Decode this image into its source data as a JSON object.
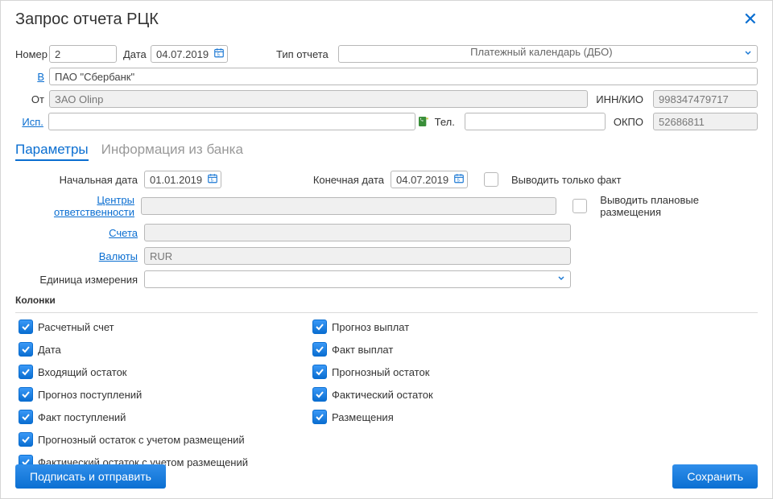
{
  "window": {
    "title": "Запрос отчета РЦК"
  },
  "header": {
    "number_label": "Номер",
    "number_value": "2",
    "date_label": "Дата",
    "date_value": "04.07.2019",
    "type_label": "Тип отчета",
    "type_value": "Платежный календарь (ДБО)",
    "b_label": "В",
    "b_value": "ПАО \"Сбербанк\"",
    "ot_label": "От",
    "ot_value": "ЗАО Olinp",
    "inn_label": "ИНН/КИО",
    "inn_value": "998347479717",
    "isp_label": "Исп.",
    "isp_value": "",
    "tel_label": "Тел.",
    "tel_value": "",
    "okpo_label": "ОКПО",
    "okpo_value": "52686811"
  },
  "tabs": {
    "params": "Параметры",
    "bank_info": "Информация из банка"
  },
  "params": {
    "start_date_label": "Начальная дата",
    "start_date_value": "01.01.2019",
    "end_date_label": "Конечная дата",
    "end_date_value": "04.07.2019",
    "fact_only_label": "Выводить только факт",
    "resp_centers_label": "Центры ответственности",
    "plan_placements_label": "Выводить плановые размещения",
    "accounts_label": "Счета",
    "currencies_label": "Валюты",
    "currencies_value": "RUR",
    "unit_label": "Единица измерения",
    "unit_value": ""
  },
  "columns_section_label": "Колонки",
  "columns_left": [
    "Расчетный счет",
    "Дата",
    "Входящий остаток",
    "Прогноз поступлений",
    "Факт поступлений",
    "Прогнозный остаток с учетом размещений",
    "Фактический остаток с учетом размещений"
  ],
  "columns_right": [
    "Прогноз выплат",
    "Факт выплат",
    "Прогнозный остаток",
    "Фактический остаток",
    "Размещения"
  ],
  "footer": {
    "sign_send": "Подписать и отправить",
    "save": "Сохранить"
  }
}
